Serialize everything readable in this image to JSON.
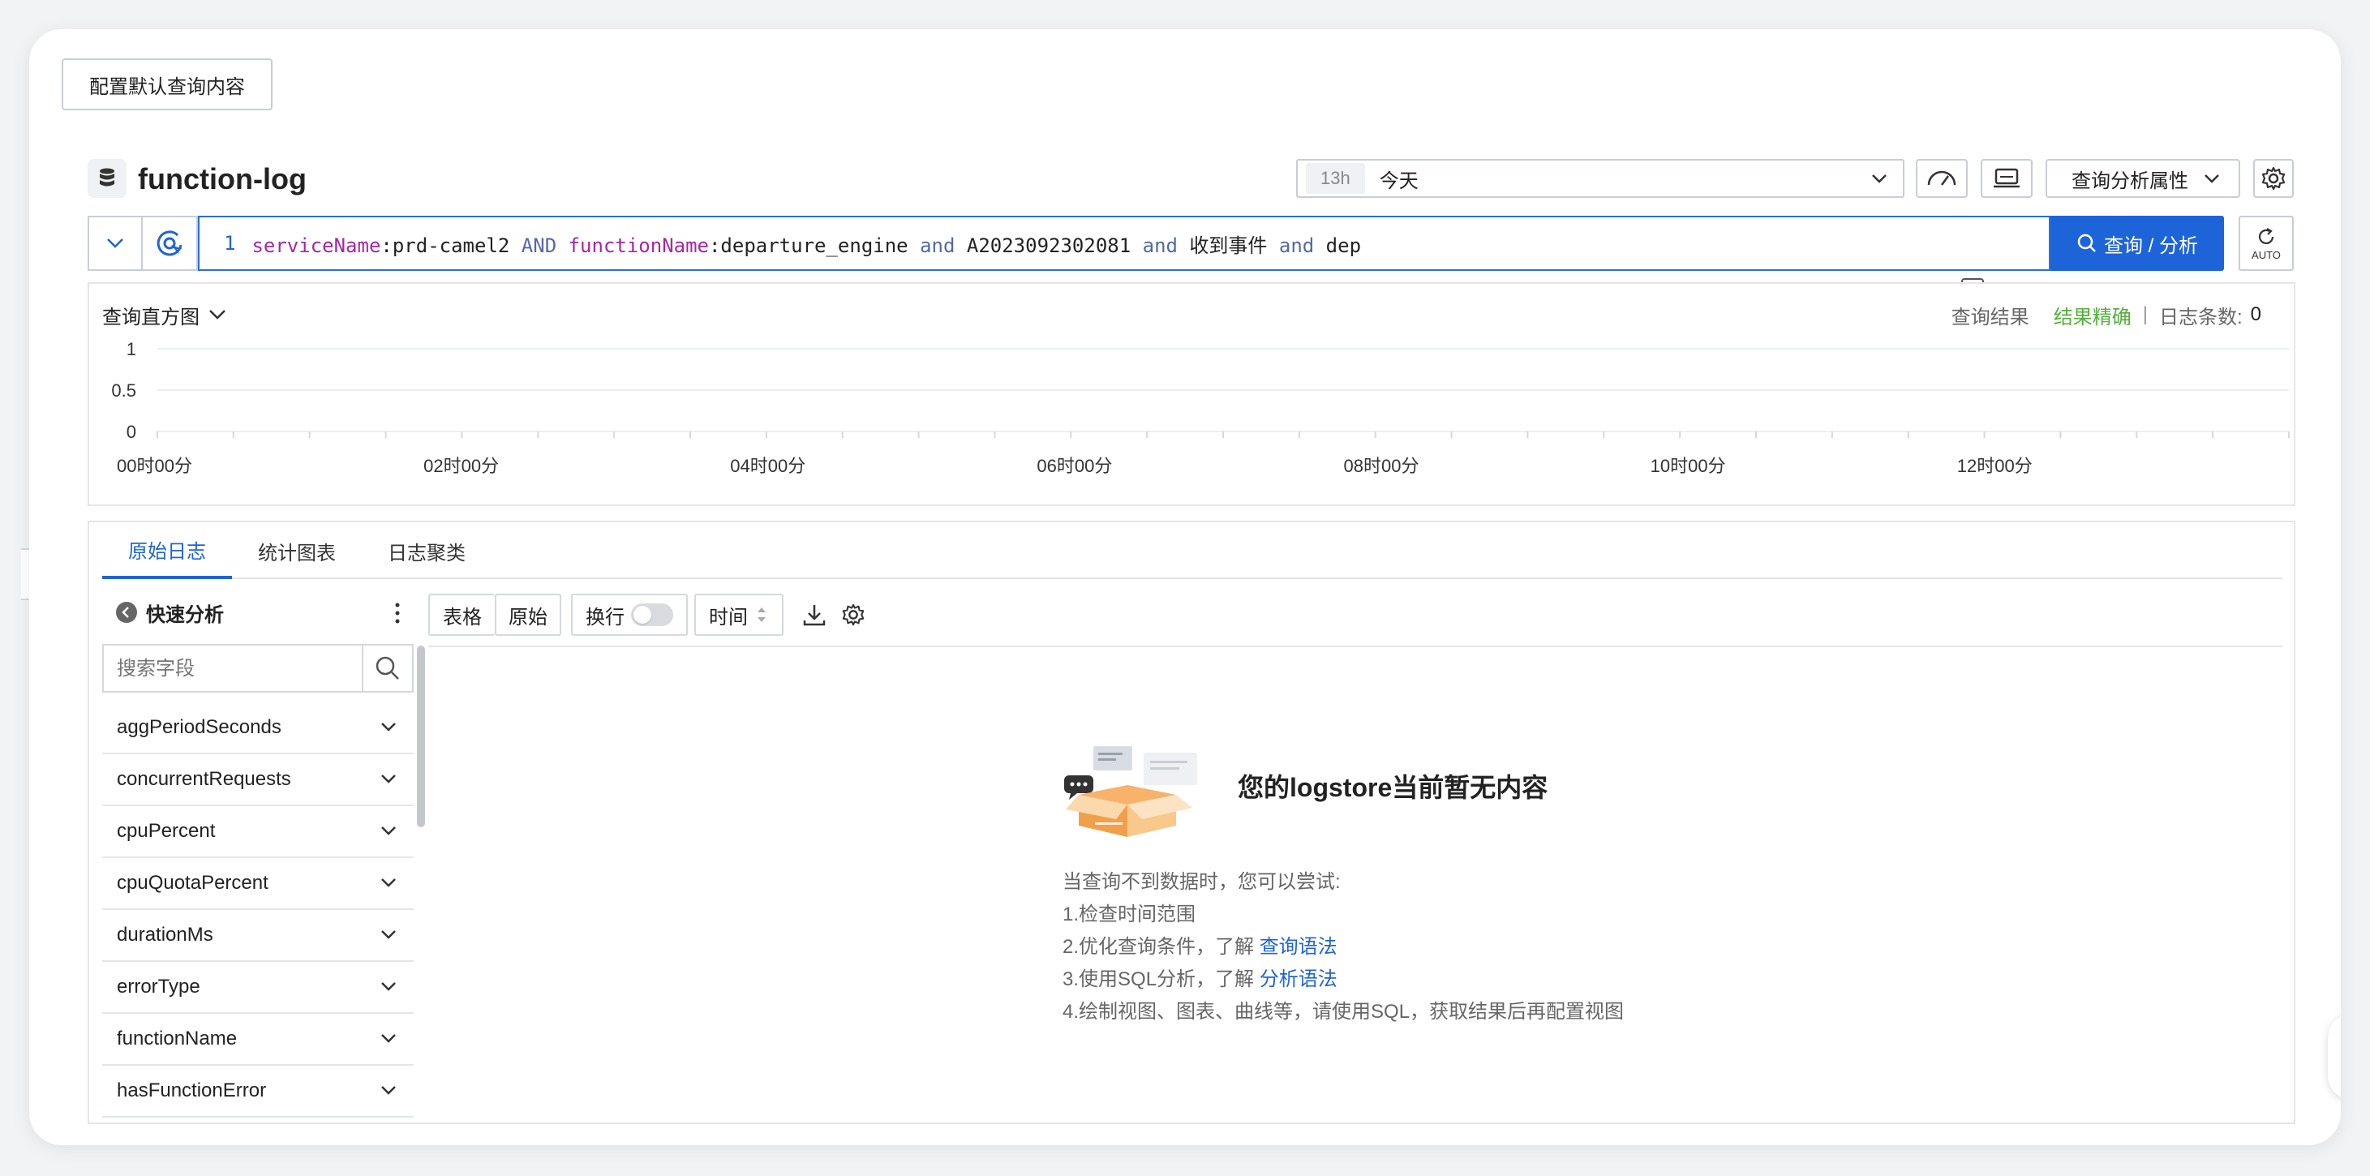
{
  "config_button": "配置默认查询内容",
  "logstore": {
    "name": "function-log"
  },
  "time_picker": {
    "badge": "13h",
    "label": "今天"
  },
  "query_attributes_label": "查询分析属性",
  "query": {
    "line_number": "1",
    "tokens": [
      {
        "text": "serviceName",
        "kind": "field"
      },
      {
        "text": ":prd-camel2 ",
        "kind": "plain"
      },
      {
        "text": "AND ",
        "kind": "op"
      },
      {
        "text": "functionName",
        "kind": "field"
      },
      {
        "text": ":departure_engine ",
        "kind": "plain"
      },
      {
        "text": "and ",
        "kind": "op"
      },
      {
        "text": "A2023092302081 ",
        "kind": "plain"
      },
      {
        "text": "and ",
        "kind": "op"
      },
      {
        "text": "收到事件 ",
        "kind": "plain"
      },
      {
        "text": "and ",
        "kind": "op"
      },
      {
        "text": "dep",
        "kind": "plain"
      }
    ]
  },
  "search_button": "查询 / 分析",
  "auto_label": "AUTO",
  "histogram": {
    "title": "查询直方图",
    "status_label": "查询结果",
    "status_value": "结果精确",
    "status_color": "#52b03a",
    "divider": "|",
    "count_label": "日志条数:",
    "count_value": "0"
  },
  "chart_data": {
    "type": "bar",
    "categories": [
      "00时00分",
      "02时00分",
      "04时00分",
      "06时00分",
      "08时00分",
      "10时00分",
      "12时00分"
    ],
    "values": [],
    "y_ticks": [
      "1",
      "0.5",
      "0"
    ],
    "ylim": [
      0,
      1
    ],
    "grid": true
  },
  "tabs": [
    {
      "label": "原始日志",
      "active": true
    },
    {
      "label": "统计图表",
      "active": false
    },
    {
      "label": "日志聚类",
      "active": false
    }
  ],
  "quick_analysis": {
    "title": "快速分析",
    "search_placeholder": "搜索字段",
    "fields": [
      "aggPeriodSeconds",
      "concurrentRequests",
      "cpuPercent",
      "cpuQuotaPercent",
      "durationMs",
      "errorType",
      "functionName",
      "hasFunctionError"
    ]
  },
  "toolbar": {
    "table": "表格",
    "raw": "原始",
    "wrap": "换行",
    "time": "时间"
  },
  "empty_state": {
    "title": "您的logstore当前暂无内容",
    "intro": "当查询不到数据时，您可以尝试:",
    "tip1": "1.检查时间范围",
    "tip2_prefix": "2.优化查询条件，了解 ",
    "tip2_link": "查询语法",
    "tip3_prefix": "3.使用SQL分析，了解 ",
    "tip3_link": "分析语法",
    "tip4": "4.绘制视图、图表、曲线等，请使用SQL，获取结果后再配置视图"
  },
  "colors": {
    "accent": "#1e64d9",
    "search_button": "#1e64d9",
    "field_keyword": "#a626a4",
    "operator_keyword": "#5468a8"
  }
}
